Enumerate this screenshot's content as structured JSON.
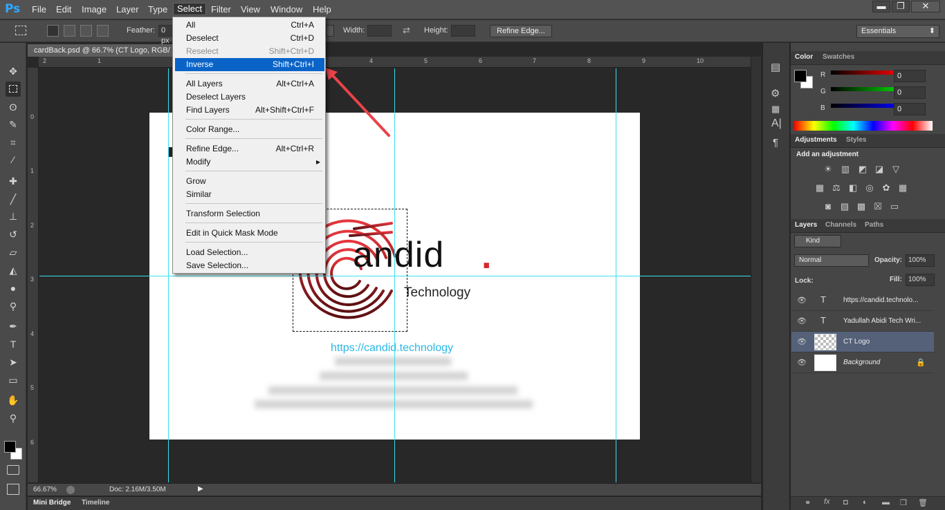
{
  "app": {
    "logo": "Ps"
  },
  "menubar": [
    "File",
    "Edit",
    "Image",
    "Layer",
    "Type",
    "Select",
    "Filter",
    "View",
    "Window",
    "Help"
  ],
  "window_buttons": [
    "▬",
    "❐",
    "✕"
  ],
  "options": {
    "feather_label": "Feather:",
    "feather_value": "0 px",
    "width_label": "Width:",
    "height_label": "Height:",
    "refine_label": "Refine Edge...",
    "workspace": "Essentials"
  },
  "document": {
    "tab_title": "cardBack.psd @ 66.7% (CT Logo, RGB/",
    "zoom": "66.67%",
    "doc_info": "Doc: 2.16M/3.50M"
  },
  "ruler_top": [
    "2",
    "1",
    "4",
    "5",
    "6",
    "7",
    "8",
    "9",
    "10"
  ],
  "ruler_left": [
    "0",
    "1",
    "2",
    "3",
    "4",
    "5",
    "6"
  ],
  "canvas": {
    "logo_word": "andid",
    "logo_dot": ".",
    "logo_sub": "Technology",
    "url": "https://candid.technology",
    "colors": {
      "logo_red": "#d42a2f",
      "guide": "#39e0f0",
      "url": "#29b8e6"
    }
  },
  "bottom_tabs": [
    "Mini Bridge",
    "Timeline"
  ],
  "select_menu": [
    {
      "label": "All",
      "shortcut": "Ctrl+A"
    },
    {
      "label": "Deselect",
      "shortcut": "Ctrl+D"
    },
    {
      "label": "Reselect",
      "shortcut": "Shift+Ctrl+D",
      "disabled": true
    },
    {
      "label": "Inverse",
      "shortcut": "Shift+Ctrl+I",
      "highlighted": true
    },
    {
      "label": "All Layers",
      "shortcut": "Alt+Ctrl+A"
    },
    {
      "label": "Deselect Layers",
      "shortcut": ""
    },
    {
      "label": "Find Layers",
      "shortcut": "Alt+Shift+Ctrl+F"
    },
    {
      "label": "Color Range...",
      "shortcut": ""
    },
    {
      "label": "Refine Edge...",
      "shortcut": "Alt+Ctrl+R"
    },
    {
      "label": "Modify",
      "shortcut": "▸"
    },
    {
      "label": "Grow",
      "shortcut": ""
    },
    {
      "label": "Similar",
      "shortcut": ""
    },
    {
      "label": "Transform Selection",
      "shortcut": ""
    },
    {
      "label": "Edit in Quick Mask Mode",
      "shortcut": ""
    },
    {
      "label": "Load Selection...",
      "shortcut": ""
    },
    {
      "label": "Save Selection...",
      "shortcut": ""
    }
  ],
  "color_panel": {
    "tabs": [
      "Color",
      "Swatches"
    ],
    "r_label": "R",
    "g_label": "G",
    "b_label": "B",
    "r": "0",
    "g": "0",
    "b": "0"
  },
  "adjustments_panel": {
    "tabs": [
      "Adjustments",
      "Styles"
    ],
    "heading": "Add an adjustment"
  },
  "layers_panel": {
    "tabs": [
      "Layers",
      "Channels",
      "Paths"
    ],
    "kind": "Kind",
    "blend": "Normal",
    "opacity_label": "Opacity:",
    "opacity": "100%",
    "lock_label": "Lock:",
    "fill_label": "Fill:",
    "fill": "100%",
    "layers": [
      {
        "name": "https://candid.technolo...",
        "type": "T"
      },
      {
        "name": "Yadullah Abidi Tech Wri...",
        "type": "T"
      },
      {
        "name": "CT Logo",
        "type": "img"
      },
      {
        "name": "Background",
        "type": "bg"
      }
    ]
  }
}
